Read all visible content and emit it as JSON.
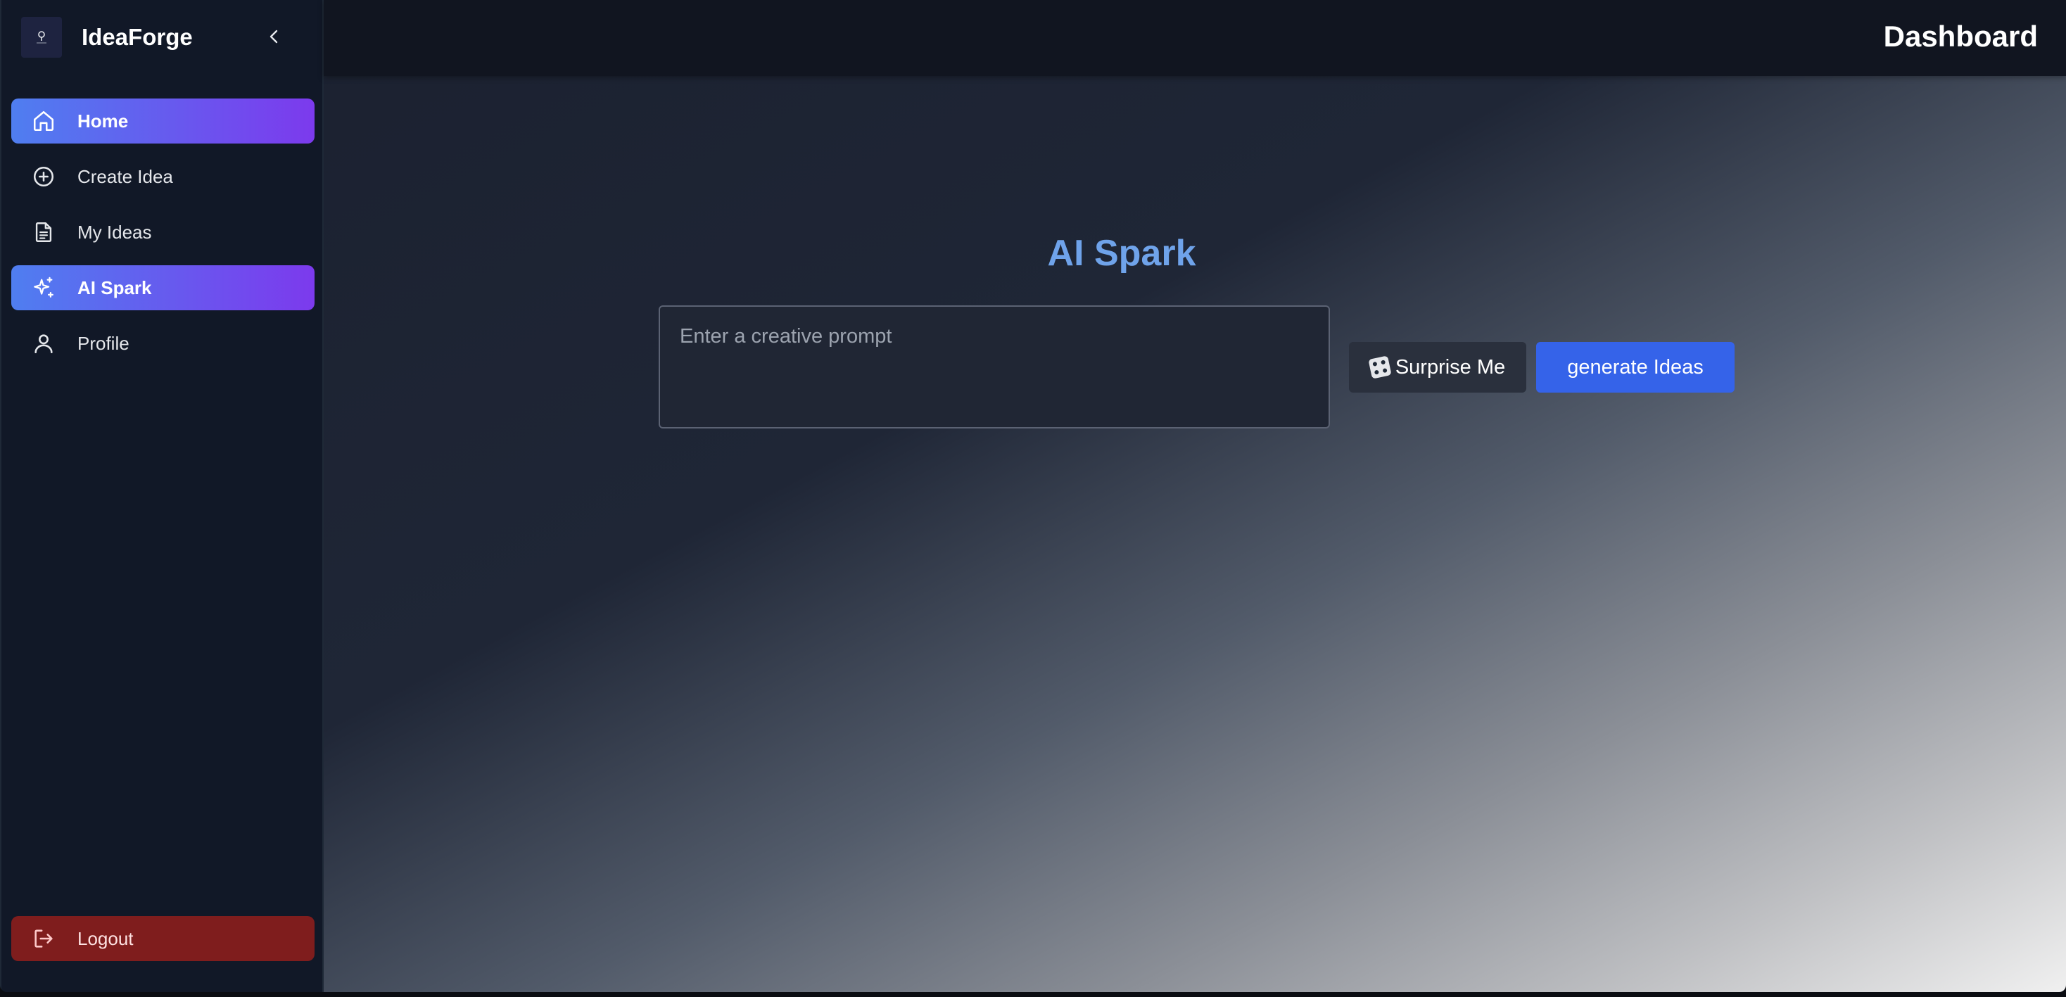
{
  "sidebar": {
    "brand_name": "IdeaForge",
    "items": [
      {
        "label": "Home",
        "icon": "home-icon"
      },
      {
        "label": "Create Idea",
        "icon": "plus-circle-icon"
      },
      {
        "label": "My Ideas",
        "icon": "document-icon"
      },
      {
        "label": "AI Spark",
        "icon": "sparkles-icon"
      },
      {
        "label": "Profile",
        "icon": "user-icon"
      }
    ],
    "logout_label": "Logout"
  },
  "header": {
    "title": "Dashboard"
  },
  "main": {
    "heading": "AI Spark",
    "prompt_placeholder": "Enter a creative prompt",
    "surprise_label": "Surprise Me",
    "generate_label": "generate Ideas"
  },
  "colors": {
    "active_gradient_start": "#4f7ef0",
    "active_gradient_end": "#7c3aed",
    "heading_color": "#6fa3ea",
    "generate_button": "#3563e9",
    "logout_button": "#7f1d1d"
  }
}
